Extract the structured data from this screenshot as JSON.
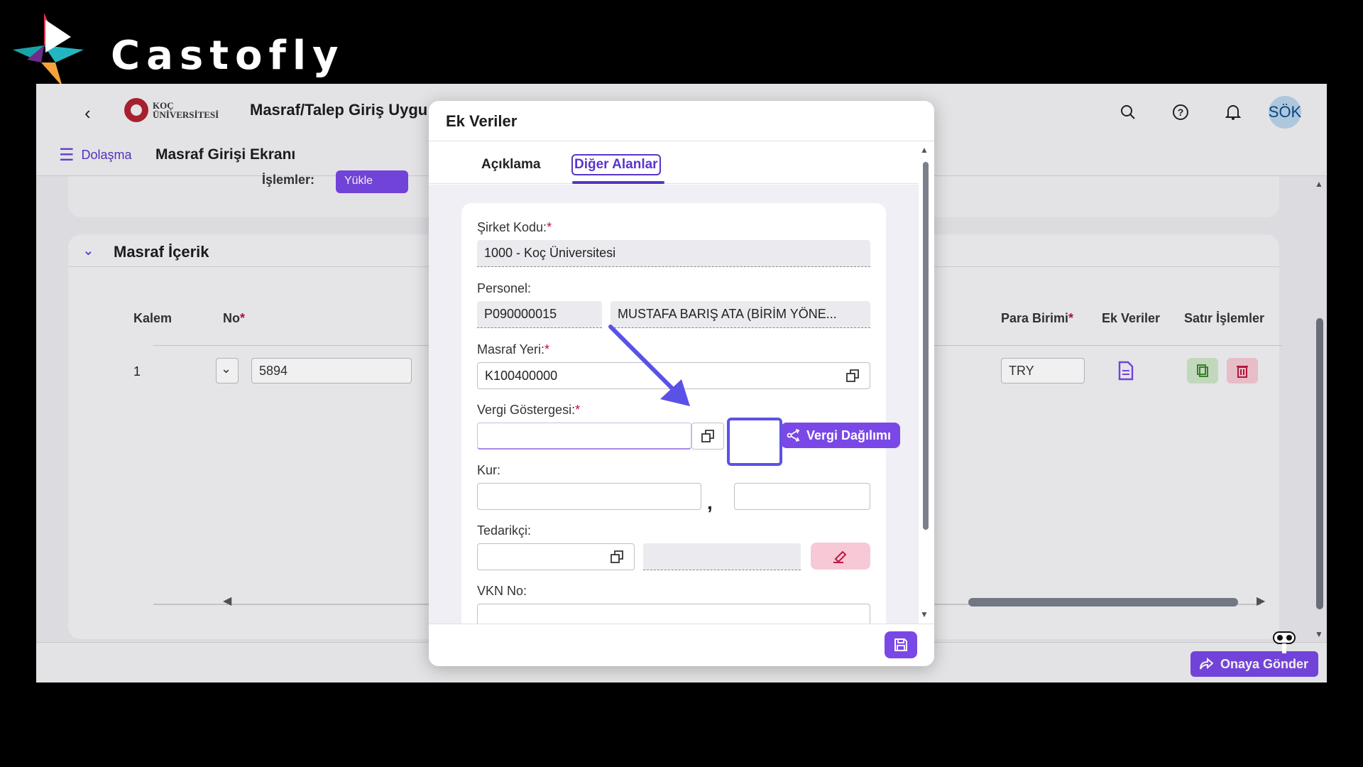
{
  "brand": {
    "name": "Castofly"
  },
  "shell": {
    "back_glyph": "‹",
    "logo_line1": "KOÇ",
    "logo_line2": "ÜNİVERSİTESİ",
    "app_title": "Masraf/Talep Giriş Uygu",
    "avatar": "SÖK",
    "nav_label": "Dolaşma",
    "screen_title": "Masraf Girişi Ekranı"
  },
  "operations": {
    "label": "İşlemler:",
    "button": "Yükle"
  },
  "section": {
    "title": "Masraf İçerik",
    "headers": {
      "kalem": "Kalem",
      "no": "No",
      "para_birimi": "Para Birimi",
      "ek_veriler": "Ek Veriler",
      "satir_islemleri": "Satır İşlemler"
    },
    "row": {
      "kalem": "1",
      "no": "5894",
      "para_birimi": "TRY"
    }
  },
  "footer": {
    "send_label": "Onaya Gönder"
  },
  "dialog": {
    "title": "Ek Veriler",
    "tabs": [
      {
        "label": "Açıklama",
        "active": false
      },
      {
        "label": "Diğer Alanlar",
        "active": true
      }
    ],
    "fields": {
      "sirket_kodu": {
        "label": "Şirket Kodu:",
        "value": "1000 - Koç Üniversitesi"
      },
      "personel": {
        "label": "Personel:",
        "code": "P090000015",
        "name": "MUSTAFA BARIŞ  ATA (BİRİM YÖNE..."
      },
      "masraf_yeri": {
        "label": "Masraf Yeri:",
        "value": "K100400000"
      },
      "vergi_gostergesi": {
        "label": "Vergi Göstergesi:",
        "value": "",
        "button": "Vergi Dağılımı"
      },
      "kur": {
        "label": "Kur:",
        "separator": ","
      },
      "tedarikci": {
        "label": "Tedarikçi:"
      },
      "vkn_no": {
        "label": "VKN No:"
      }
    }
  },
  "colors": {
    "accent": "#7a48e6",
    "highlight": "#5a52e6",
    "required": "#b3124b"
  }
}
